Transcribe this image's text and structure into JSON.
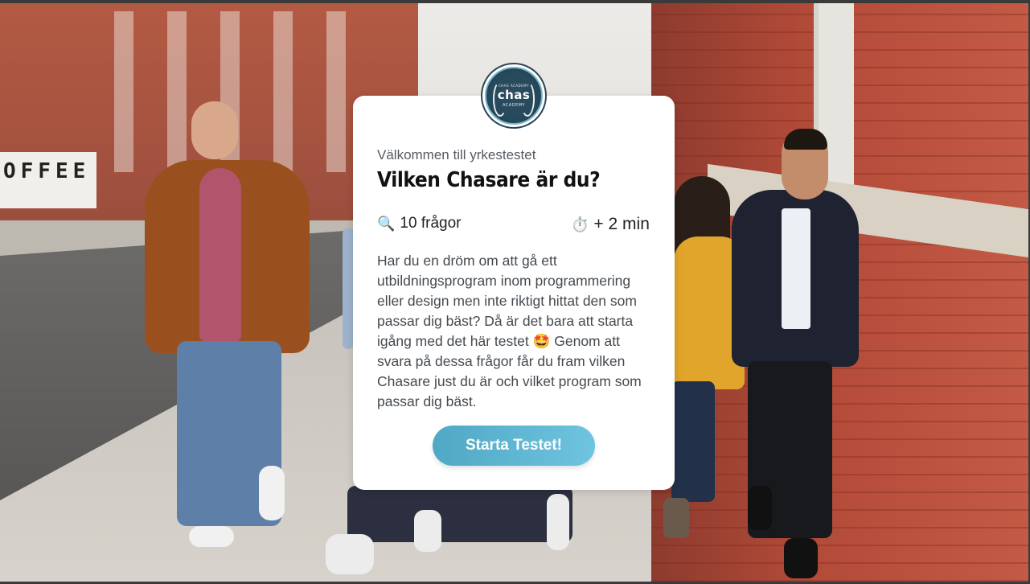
{
  "logo": {
    "top_text": "CHAS ACADEMY",
    "name": "chas",
    "sub_text": "ACADEMY",
    "icon": "chas-academy-logo-icon"
  },
  "background": {
    "cafe_sign": "OFFEE"
  },
  "card": {
    "welcome": "Välkommen till yrkestestet",
    "title": "Vilken Chasare är du?",
    "questions_icon": "magnifier-icon",
    "questions_label": "10 frågor",
    "time_icon": "stopwatch-icon",
    "time_label": "+ 2 min",
    "description": "Har du en dröm om att gå ett utbildningsprogram inom programmering eller design men inte riktigt hittat den som passar dig bäst? Då är det bara att starta igång med det här testet 🤩 Genom att svara på dessa frågor får du fram vilken Chasare just du är och vilket program som passar dig bäst.",
    "start_button": "Starta Testet!"
  },
  "colors": {
    "button_gradient_start": "#4fa8c4",
    "button_gradient_end": "#6fc4df",
    "card_bg": "#ffffff",
    "logo_navy": "#27495c"
  }
}
